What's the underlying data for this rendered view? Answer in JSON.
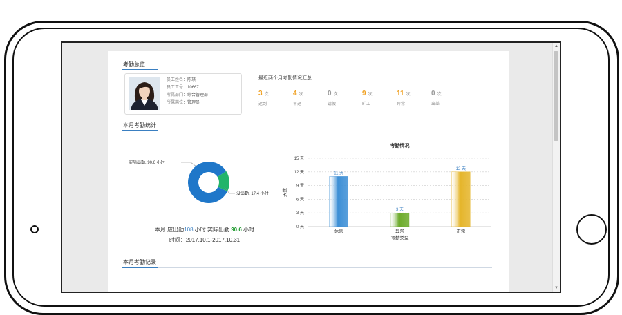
{
  "overview": {
    "title": "考勤总览",
    "employee": {
      "name_label": "员工姓名：",
      "name": "陈琪",
      "id_label": "员工工号：",
      "id": "10667",
      "dept_label": "所属部门：",
      "dept": "综合管理部",
      "post_label": "所属岗位：",
      "post": "管理员"
    },
    "summary_title": "最近两个月考勤情况汇总",
    "stats": [
      {
        "value": "3",
        "unit": "次",
        "label": "迟到",
        "color": "#f0a020"
      },
      {
        "value": "4",
        "unit": "次",
        "label": "早退",
        "color": "#f0a020"
      },
      {
        "value": "0",
        "unit": "次",
        "label": "请假",
        "color": "#999999"
      },
      {
        "value": "9",
        "unit": "次",
        "label": "旷工",
        "color": "#f0a020"
      },
      {
        "value": "11",
        "unit": "次",
        "label": "异常",
        "color": "#f0a020"
      },
      {
        "value": "0",
        "unit": "次",
        "label": "出差",
        "color": "#999999"
      }
    ]
  },
  "month_stats": {
    "title": "本月考勤统计",
    "donut": {
      "actual_label": "实际出勤, 90.6 小时",
      "absent_label": "没出勤, 17.4 小时",
      "colors": {
        "actual": "#1f77c9",
        "absent": "#22b46a"
      }
    },
    "caption": {
      "prefix": "本月 应出勤",
      "required": "108",
      "mid": "小时 实际出勤",
      "actual": "90.6",
      "suffix": "小时"
    },
    "period": "时间：2017.10.1-2017.10.31"
  },
  "records": {
    "title": "本月考勤记录"
  },
  "chart_data": [
    {
      "type": "pie",
      "slices": [
        {
          "label": "实际出勤",
          "value": 90.6,
          "unit": "小时"
        },
        {
          "label": "没出勤",
          "value": 17.4,
          "unit": "小时"
        }
      ]
    },
    {
      "type": "bar",
      "title": "考勤情况",
      "xlabel": "考勤类型",
      "ylabel": "天数",
      "categories": [
        "休息",
        "异常",
        "正常"
      ],
      "values": [
        11,
        3,
        12
      ],
      "value_labels": [
        "11 天",
        "3 天",
        "12 天"
      ],
      "colors": [
        "#3d8fd6",
        "#6cab2b",
        "#e5b52a"
      ],
      "ylim": [
        0,
        15
      ],
      "yticks": [
        0,
        3,
        6,
        9,
        12,
        15
      ],
      "ytick_labels": [
        "0 天",
        "3 天",
        "6 天",
        "9 天",
        "12 天",
        "15 天"
      ],
      "grid": true
    }
  ]
}
